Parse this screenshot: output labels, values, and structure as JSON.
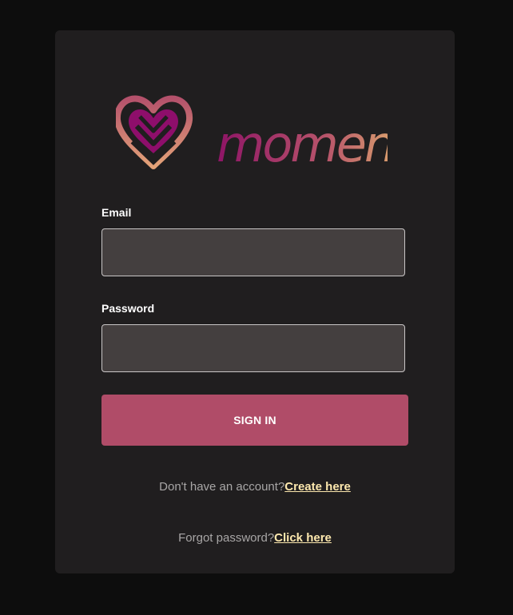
{
  "brand": {
    "logo_text": "momentz",
    "colors": {
      "gradient_start": "#8e1466",
      "gradient_mid": "#b8556a",
      "gradient_end": "#f0d070",
      "heart_outer_top": "#b4516b",
      "heart_outer_bottom": "#e3a278",
      "heart_inner": "#8e0e6b"
    }
  },
  "form": {
    "email_label": "Email",
    "email_value": "",
    "password_label": "Password",
    "password_value": "",
    "submit_label": "SIGN IN"
  },
  "footer": {
    "signup_prompt": "Don't have an account?",
    "signup_link": "Create here",
    "forgot_prompt": "Forgot password?",
    "forgot_link": "Click here"
  },
  "colors": {
    "background": "#0d0d0d",
    "card": "#201e1f",
    "input_bg": "#443f3f",
    "button": "#b04c68",
    "link": "#fde8ae",
    "muted_text": "#a8a6a6"
  }
}
